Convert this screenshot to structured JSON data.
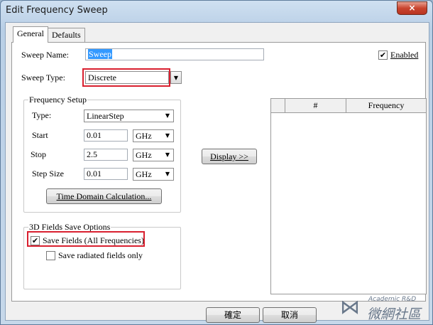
{
  "window": {
    "title": "Edit Frequency Sweep",
    "close_glyph": "×"
  },
  "tabs": [
    {
      "label": "General",
      "active": true
    },
    {
      "label": "Defaults",
      "active": false
    }
  ],
  "general": {
    "sweep_name_label": "Sweep Name:",
    "sweep_name_value": "Sweep",
    "enabled_label": "Enabled",
    "enabled_checked": true,
    "sweep_type_label": "Sweep Type:",
    "sweep_type_value": "Discrete"
  },
  "frequency_setup": {
    "title": "Frequency Setup",
    "type_label": "Type:",
    "type_value": "LinearStep",
    "start_label": "Start",
    "start_value": "0.01",
    "start_unit": "GHz",
    "stop_label": "Stop",
    "stop_value": "2.5",
    "stop_unit": "GHz",
    "step_label": "Step Size",
    "step_value": "0.01",
    "step_unit": "GHz",
    "time_domain_button": "Time Domain Calculation..."
  },
  "display_button": "Display >>",
  "table": {
    "columns": [
      "#",
      "Frequency"
    ]
  },
  "fields_save": {
    "title": "3D Fields Save Options",
    "save_fields_label": "Save Fields (All Frequencies)",
    "save_fields_checked": true,
    "radiated_label": "Save radiated fields only",
    "radiated_checked": false
  },
  "footer": {
    "ok_label": "確定",
    "cancel_label": "取消"
  },
  "watermark": {
    "line1": "Academic R&D",
    "line2": "微網社區"
  },
  "colors": {
    "highlight_box": "#d9202f",
    "selection": "#3399ff"
  }
}
